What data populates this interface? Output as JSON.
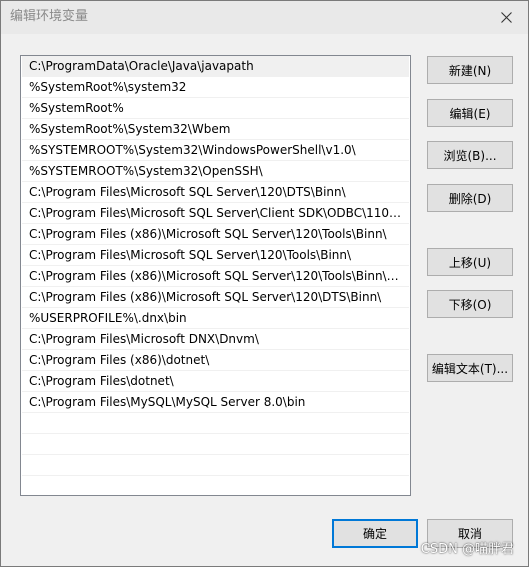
{
  "window": {
    "title": "编辑环境变量"
  },
  "paths": [
    "C:\\ProgramData\\Oracle\\Java\\javapath",
    "%SystemRoot%\\system32",
    "%SystemRoot%",
    "%SystemRoot%\\System32\\Wbem",
    "%SYSTEMROOT%\\System32\\WindowsPowerShell\\v1.0\\",
    "%SYSTEMROOT%\\System32\\OpenSSH\\",
    "C:\\Program Files\\Microsoft SQL Server\\120\\DTS\\Binn\\",
    "C:\\Program Files\\Microsoft SQL Server\\Client SDK\\ODBC\\110\\T...",
    "C:\\Program Files (x86)\\Microsoft SQL Server\\120\\Tools\\Binn\\",
    "C:\\Program Files\\Microsoft SQL Server\\120\\Tools\\Binn\\",
    "C:\\Program Files (x86)\\Microsoft SQL Server\\120\\Tools\\Binn\\M...",
    "C:\\Program Files (x86)\\Microsoft SQL Server\\120\\DTS\\Binn\\",
    "%USERPROFILE%\\.dnx\\bin",
    "C:\\Program Files\\Microsoft DNX\\Dnvm\\",
    "C:\\Program Files (x86)\\dotnet\\",
    "C:\\Program Files\\dotnet\\",
    "C:\\Program Files\\MySQL\\MySQL Server 8.0\\bin"
  ],
  "buttons": {
    "new": "新建(N)",
    "edit": "编辑(E)",
    "browse": "浏览(B)...",
    "delete": "删除(D)",
    "move_up": "上移(U)",
    "move_down": "下移(O)",
    "edit_text": "编辑文本(T)...",
    "ok": "确定",
    "cancel": "取消"
  },
  "watermark": "CSDN @喵胖君",
  "colors": {
    "selection": "#f0f0f0",
    "default_button_border": "#0078d7"
  }
}
